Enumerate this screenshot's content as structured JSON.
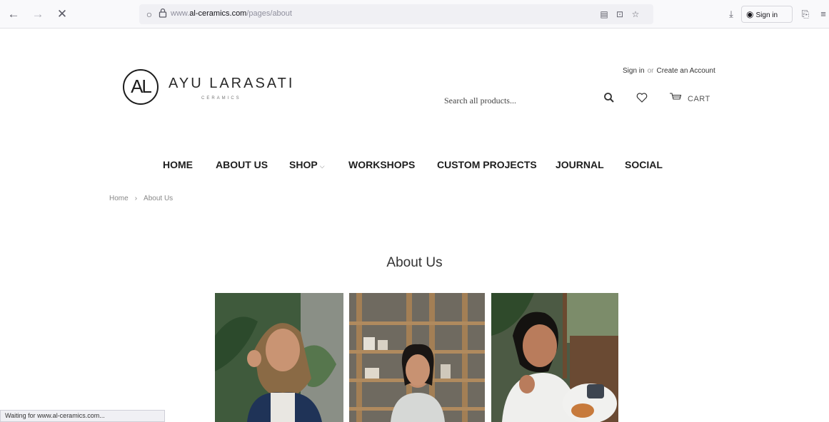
{
  "browser": {
    "url_prefix": "www.",
    "url_host": "al-ceramics.com",
    "url_path": "/pages/about",
    "sign_in_label": "Sign in",
    "status_text": "Waiting for www.al-ceramics.com..."
  },
  "header": {
    "logo_mark": "AL",
    "brand_name": "AYU LARASATI",
    "brand_sub": "CERAMICS",
    "sign_in": "Sign in",
    "or": "or",
    "create_account": "Create an Account",
    "search_placeholder": "Search all products...",
    "cart_label": "CART"
  },
  "nav": {
    "items": [
      {
        "label": "HOME"
      },
      {
        "label": "ABOUT US"
      },
      {
        "label": "SHOP"
      },
      {
        "label": "WORKSHOPS"
      },
      {
        "label": "CUSTOM PROJECTS"
      },
      {
        "label": "JOURNAL"
      },
      {
        "label": "SOCIAL"
      }
    ]
  },
  "breadcrumb": {
    "home": "Home",
    "separator": "›",
    "current": "About Us"
  },
  "page": {
    "title": "About Us"
  },
  "icons": {
    "back": "back-arrow-icon",
    "forward": "forward-arrow-icon",
    "stop": "close-icon",
    "search": "search-icon",
    "wishlist": "heart-icon",
    "cart": "cart-icon"
  }
}
